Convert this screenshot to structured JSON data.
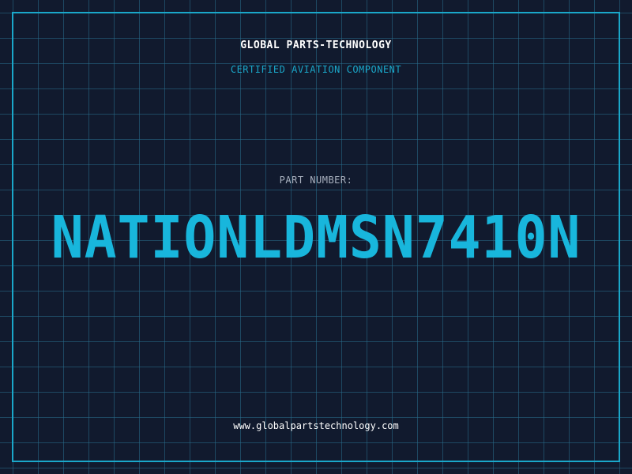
{
  "header": {
    "title": "GLOBAL PARTS-TECHNOLOGY",
    "subtitle": "CERTIFIED AVIATION COMPONENT"
  },
  "part": {
    "label": "PART NUMBER:",
    "number": "NATIONLDMSN7410N"
  },
  "footer": {
    "website": "www.globalpartstechnology.com"
  },
  "colors": {
    "background": "#111a2e",
    "grid": "#286e8c",
    "accent": "#18b6dc",
    "frame": "#1aa7c9",
    "label": "#a9b1bf",
    "text": "#ffffff"
  }
}
